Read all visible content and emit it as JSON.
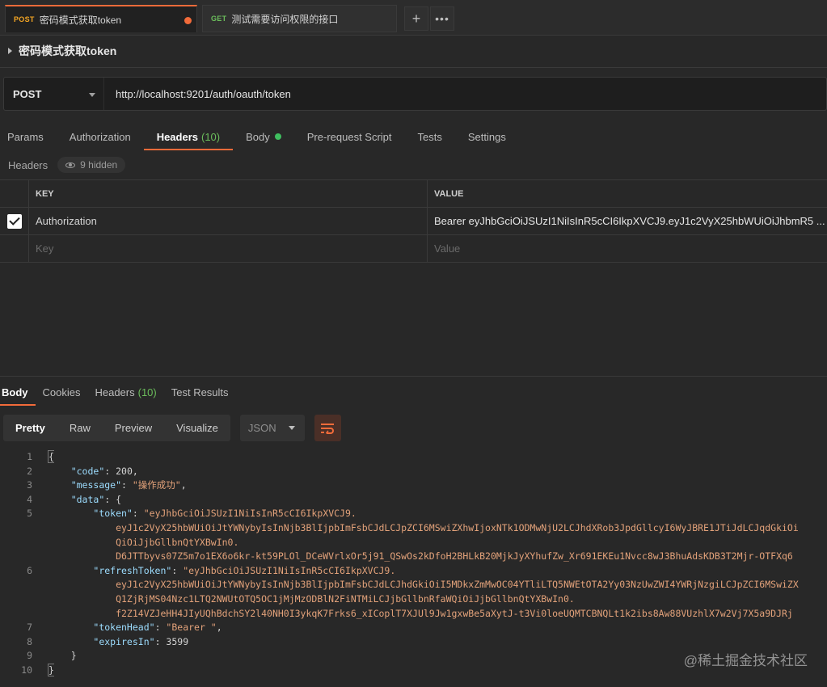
{
  "tabs": [
    {
      "method": "POST",
      "title": "密码模式获取token",
      "active": true
    },
    {
      "method": "GET",
      "title": "测试需要访问权限的接口",
      "active": false
    }
  ],
  "request": {
    "name": "密码模式获取token",
    "method": "POST",
    "url": "http://localhost:9201/auth/oauth/token"
  },
  "request_tabs": {
    "params": "Params",
    "authorization": "Authorization",
    "headers": "Headers",
    "headers_count": "(10)",
    "body": "Body",
    "prerequest": "Pre-request Script",
    "tests": "Tests",
    "settings": "Settings"
  },
  "headers_section": {
    "label": "Headers",
    "hidden": "9 hidden",
    "col_key": "KEY",
    "col_value": "VALUE",
    "rows": [
      {
        "key": "Authorization",
        "value": "Bearer eyJhbGciOiJSUzI1NiIsInR5cCI6IkpXVCJ9.eyJ1c2VyX25hbWUiOiJhbmR5 ..."
      }
    ],
    "key_placeholder": "Key",
    "value_placeholder": "Value"
  },
  "response_tabs": {
    "body": "Body",
    "cookies": "Cookies",
    "headers": "Headers",
    "headers_count": "(10)",
    "test_results": "Test Results"
  },
  "view": {
    "pretty": "Pretty",
    "raw": "Raw",
    "preview": "Preview",
    "visualize": "Visualize",
    "format": "JSON"
  },
  "code_lines": [
    {
      "num": "1",
      "parts": [
        {
          "t": "p",
          "v": "{"
        }
      ]
    },
    {
      "num": "2",
      "parts": [
        {
          "t": "p",
          "v": "    "
        },
        {
          "t": "k",
          "v": "\"code\""
        },
        {
          "t": "p",
          "v": ": "
        },
        {
          "t": "n",
          "v": "200"
        },
        {
          "t": "p",
          "v": ","
        }
      ]
    },
    {
      "num": "3",
      "parts": [
        {
          "t": "p",
          "v": "    "
        },
        {
          "t": "k",
          "v": "\"message\""
        },
        {
          "t": "p",
          "v": ": "
        },
        {
          "t": "s",
          "v": "\"操作成功\""
        },
        {
          "t": "p",
          "v": ","
        }
      ]
    },
    {
      "num": "4",
      "parts": [
        {
          "t": "p",
          "v": "    "
        },
        {
          "t": "k",
          "v": "\"data\""
        },
        {
          "t": "p",
          "v": ": {"
        }
      ]
    },
    {
      "num": "5",
      "parts": [
        {
          "t": "p",
          "v": "        "
        },
        {
          "t": "k",
          "v": "\"token\""
        },
        {
          "t": "p",
          "v": ": "
        },
        {
          "t": "s",
          "v": "\"eyJhbGciOiJSUzI1NiIsInR5cCI6IkpXVCJ9."
        }
      ]
    },
    {
      "num": "",
      "parts": [
        {
          "t": "s",
          "v": "            eyJ1c2VyX25hbWUiOiJtYWNybyIsInNjb3BlIjpbImFsbCJdLCJpZCI6MSwiZXhwIjoxNTk1ODMwNjU2LCJhdXRob3JpdGllcyI6WyJBRE1JTiJdLCJqdGkiOi"
        }
      ]
    },
    {
      "num": "",
      "parts": [
        {
          "t": "s",
          "v": "            QiOiJjbGllbnQtYXBwIn0."
        }
      ]
    },
    {
      "num": "",
      "parts": [
        {
          "t": "s",
          "v": "            D6JTTbyvs07Z5m7o1EX6o6kr-kt59PLOl_DCeWVrlxOr5j91_QSwOs2kDfoH2BHLkB20MjkJyXYhufZw_Xr691EKEu1Nvcc8wJ3BhuAdsKDB3T2Mjr-OTFXq6"
        }
      ]
    },
    {
      "num": "6",
      "parts": [
        {
          "t": "p",
          "v": "        "
        },
        {
          "t": "k",
          "v": "\"refreshToken\""
        },
        {
          "t": "p",
          "v": ": "
        },
        {
          "t": "s",
          "v": "\"eyJhbGciOiJSUzI1NiIsInR5cCI6IkpXVCJ9."
        }
      ]
    },
    {
      "num": "",
      "parts": [
        {
          "t": "s",
          "v": "            eyJ1c2VyX25hbWUiOiJtYWNybyIsInNjb3BlIjpbImFsbCJdLCJhdGkiOiI5MDkxZmMwOC04YTliLTQ5NWEtOTA2Yy03NzUwZWI4YWRjNzgiLCJpZCI6MSwiZX"
        }
      ]
    },
    {
      "num": "",
      "parts": [
        {
          "t": "s",
          "v": "            Q1ZjRjMS04Nzc1LTQ2NWUtOTQ5OC1jMjMzODBlN2FiNTMiLCJjbGllbnRfaWQiOiJjbGllbnQtYXBwIn0."
        }
      ]
    },
    {
      "num": "",
      "parts": [
        {
          "t": "s",
          "v": "            f2Z14VZJeHH4JIyUQhBdchSY2l40NH0I3ykqK7Frks6_xICoplT7XJUl9Jw1gxwBe5aXytJ-t3Vi0loeUQMTCBNQLt1k2ibs8Aw88VUzhlX7w2Vj7X5a9DJRj"
        }
      ]
    },
    {
      "num": "7",
      "parts": [
        {
          "t": "p",
          "v": "        "
        },
        {
          "t": "k",
          "v": "\"tokenHead\""
        },
        {
          "t": "p",
          "v": ": "
        },
        {
          "t": "s",
          "v": "\"Bearer \""
        },
        {
          "t": "p",
          "v": ","
        }
      ]
    },
    {
      "num": "8",
      "parts": [
        {
          "t": "p",
          "v": "        "
        },
        {
          "t": "k",
          "v": "\"expiresIn\""
        },
        {
          "t": "p",
          "v": ": "
        },
        {
          "t": "n",
          "v": "3599"
        }
      ]
    },
    {
      "num": "9",
      "parts": [
        {
          "t": "p",
          "v": "    }"
        }
      ]
    },
    {
      "num": "10",
      "parts": [
        {
          "t": "p",
          "v": "}"
        }
      ]
    }
  ],
  "watermark": "@稀土掘金技术社区",
  "colors": {
    "accent": "#f26b3a",
    "post": "#f5a623",
    "get": "#6bbd5b",
    "json_key": "#9cdcfe",
    "json_string": "#e3a27a"
  }
}
